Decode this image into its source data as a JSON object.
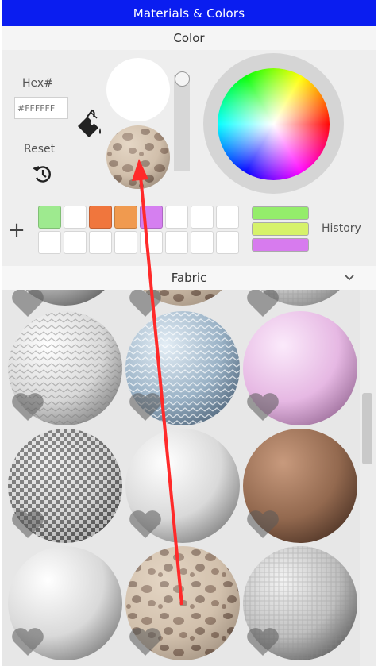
{
  "window": {
    "title": "Materials & Colors"
  },
  "color_section": {
    "label": "Color"
  },
  "hex": {
    "label": "Hex#",
    "placeholder": "#FFFFFF"
  },
  "reset": {
    "label": "Reset"
  },
  "swatches": {
    "row1": [
      "#9eea8f",
      "#ffffff",
      "#f0763d",
      "#f09a4f",
      "#d57ff0",
      "#ffffff",
      "#ffffff",
      "#ffffff"
    ],
    "row2": [
      "#ffffff",
      "#ffffff",
      "#ffffff",
      "#ffffff",
      "#ffffff",
      "#ffffff",
      "#ffffff",
      "#ffffff"
    ]
  },
  "history": {
    "label": "History",
    "colors": [
      "#94ed6b",
      "#d6f26a",
      "#d77bee"
    ]
  },
  "dropdown": {
    "selected": "Fabric"
  },
  "materials": [
    "partial-1",
    "partial-2",
    "partial-3",
    "white-chevron-fabric",
    "blue-chevron-fabric",
    "pink-fabric",
    "houndstooth-fabric",
    "white-leather",
    "brown-leather",
    "white-fabric",
    "leopard-fabric",
    "white-weave-fabric"
  ]
}
